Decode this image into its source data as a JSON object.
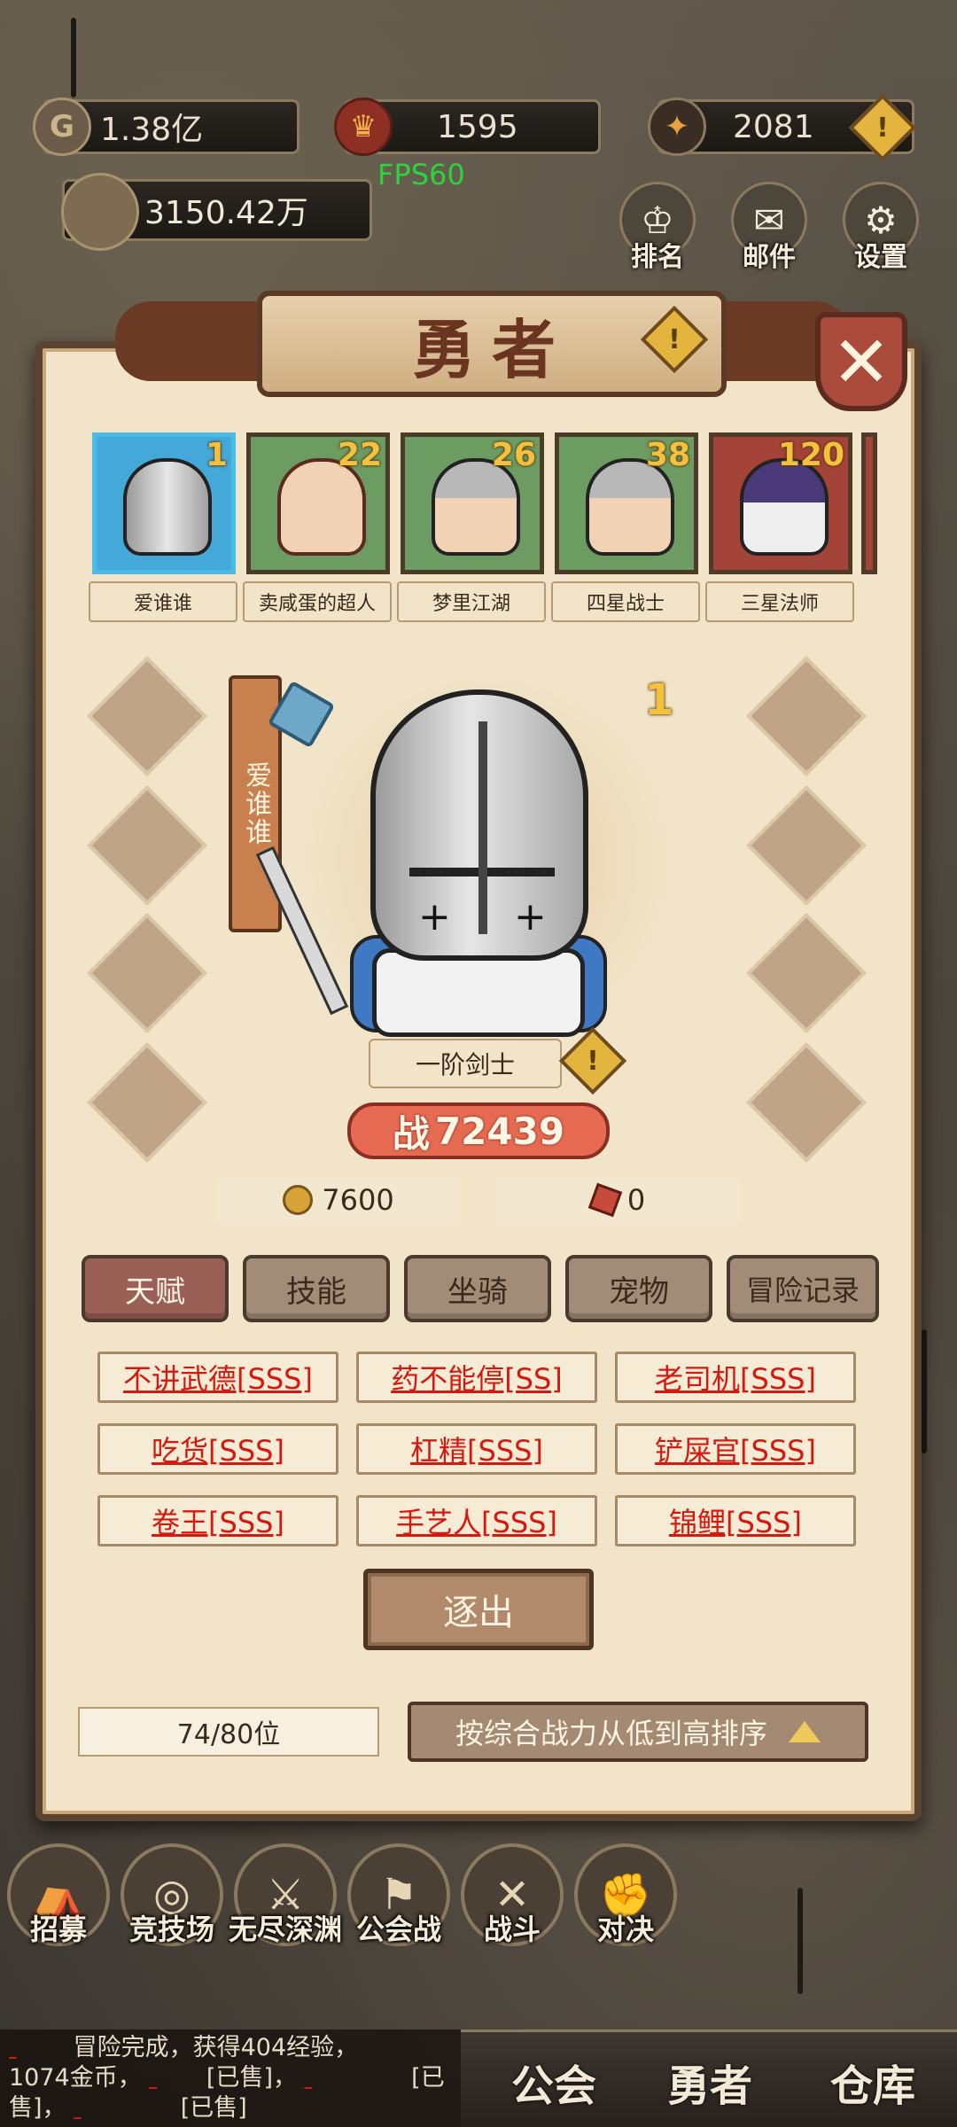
{
  "top_bar": {
    "gold": "1.38亿",
    "gold_icon": "gold-coin-icon",
    "honor": "1595",
    "honor_icon": "shield-emblem-icon",
    "soul": "2081",
    "soul_icon": "dark-orb-icon",
    "total_power": "3150.42万",
    "fps": "FPS60"
  },
  "top_buttons": [
    {
      "label": "排名",
      "icon": "ranking-icon"
    },
    {
      "label": "邮件",
      "icon": "mail-icon"
    },
    {
      "label": "设置",
      "icon": "gear-icon"
    }
  ],
  "panel": {
    "title": "勇者",
    "close_icon": "close-icon",
    "info_icon": "info-icon"
  },
  "heroes": [
    {
      "name": "爱谁谁",
      "level": "1",
      "selected": true
    },
    {
      "name": "卖咸蛋的超人",
      "level": "22",
      "selected": false
    },
    {
      "name": "梦里江湖",
      "level": "26",
      "selected": false
    },
    {
      "name": "四星战士",
      "level": "38",
      "selected": false
    },
    {
      "name": "三星法师",
      "level": "120",
      "selected": false
    }
  ],
  "selected_hero": {
    "name": "爱谁谁",
    "rank": "1",
    "class": "一阶剑士",
    "power_prefix": "战",
    "power": "72439",
    "gold_cost": "7600",
    "fragment_cost": "0"
  },
  "tabs": [
    "天赋",
    "技能",
    "坐骑",
    "宠物",
    "冒险记录"
  ],
  "active_tab": "天赋",
  "talents": [
    "不讲武德[SSS]",
    "药不能停[SS]",
    "老司机[SSS]",
    "吃货[SSS]",
    "杠精[SSS]",
    "铲屎官[SSS]",
    "卷王[SSS]",
    "手艺人[SSS]",
    "锦鲤[SSS]"
  ],
  "expel_label": "逐出",
  "hero_count": "74/80位",
  "sort_label": "按综合战力从低到高排序",
  "bottom_nav": [
    {
      "label": "招募",
      "icon": "recruit-tent-icon"
    },
    {
      "label": "竞技场",
      "icon": "arena-target-icon"
    },
    {
      "label": "无尽深渊",
      "icon": "abyss-swords-icon"
    },
    {
      "label": "公会战",
      "icon": "guild-war-banner-icon"
    },
    {
      "label": "战斗",
      "icon": "crossed-swords-icon"
    },
    {
      "label": "对决",
      "icon": "duel-fist-icon"
    }
  ],
  "chat": {
    "line1_prefix": "冒险完成，获得404经验，",
    "line2_a": "1074金币，",
    "line2_b": "[已售]，",
    "line2_c": "[已",
    "line3_a": "售]，",
    "line3_b": "[已售]"
  },
  "bottom_tabs": [
    "公会",
    "勇者",
    "仓库"
  ],
  "colors": {
    "panel_bg": "#f1e4c8",
    "talent_text": "#d5190f",
    "active_tab": "#9a5f55",
    "power_badge": "#e76b52",
    "selected_card": "#44a8d8"
  }
}
